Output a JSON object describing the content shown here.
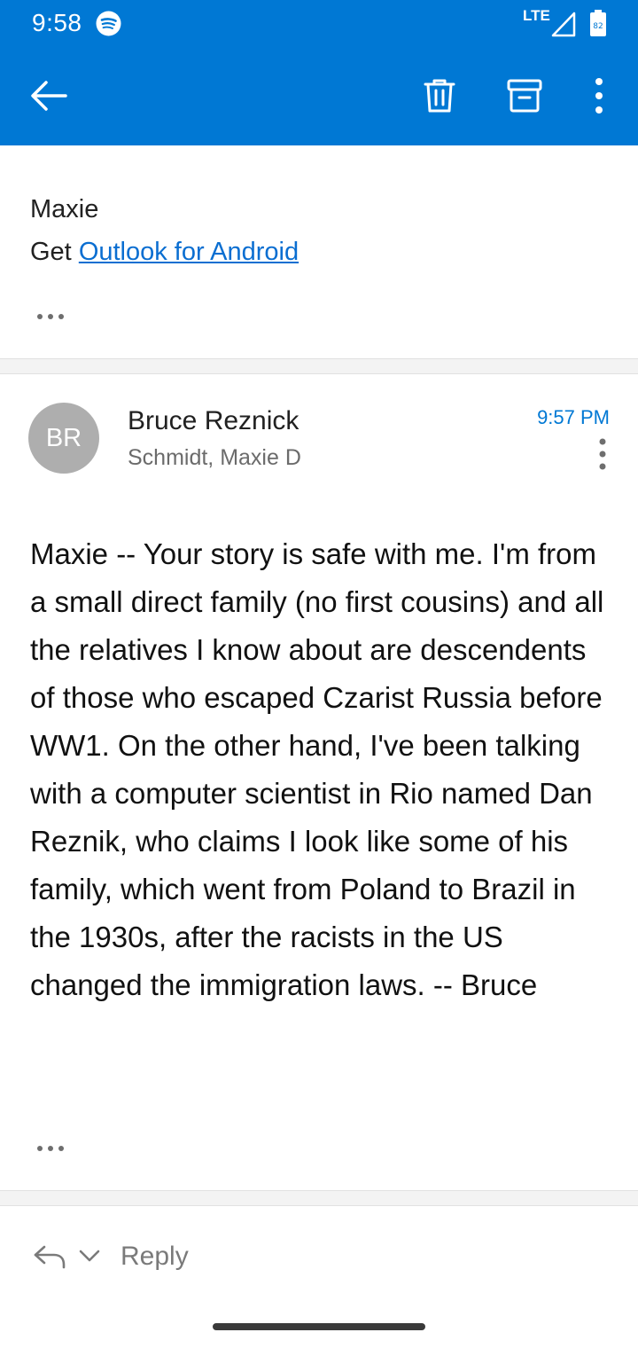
{
  "status_bar": {
    "time": "9:58",
    "network": "LTE",
    "battery_level": "82"
  },
  "toolbar": {
    "back_icon": "arrow-left-icon",
    "delete_icon": "trash-icon",
    "archive_icon": "archive-icon",
    "more_icon": "more-vertical-icon"
  },
  "message1": {
    "signature_name": "Maxie",
    "get_prefix": "Get ",
    "link_text": "Outlook for Android"
  },
  "message2": {
    "avatar_initials": "BR",
    "sender": "Bruce Reznick",
    "recipient": "Schmidt, Maxie D",
    "time": "9:57 PM",
    "body": "Maxie -- Your story is safe with me. I'm from a small direct family (no first cousins) and all the relatives I know about are descendents of those who escaped Czarist Russia before WW1. On the other hand, I've been talking with a computer scientist in Rio named Dan Reznik, who claims I look like some of his family, which went from Poland to Brazil in the 1930s, after the racists in the US changed the immigration laws. -- Bruce"
  },
  "reply_bar": {
    "label": "Reply"
  },
  "colors": {
    "accent": "#0078d4",
    "link": "#0a6ed1",
    "avatar": "#aeaeae"
  }
}
